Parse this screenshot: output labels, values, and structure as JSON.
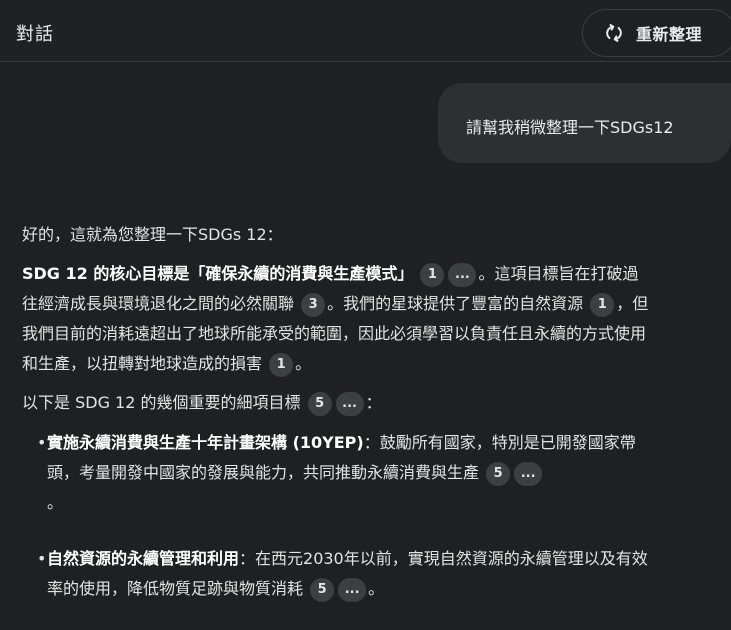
{
  "header": {
    "title": "對話",
    "regenerate_label": "重新整理",
    "regenerate_icon": "refresh-icon"
  },
  "user_message": "請幫我稍微整理一下SDGs12",
  "answer": {
    "intro": "好的，這就為您整理一下SDGs 12：",
    "core": {
      "bold": "SDG 12 的核心目標是「確保永續的消費與生產模式」",
      "text1": "。這項目標旨在打破過往經濟成長與環境退化之間的必然關聯",
      "text2": "。我們的星球提供了豐富的自然資源",
      "text3": "，但我們目前的消耗遠超出了地球所能承受的範圍，因此必須學習以負責任且永續的方式使用和生產，以扭轉對地球造成的損害",
      "text4": "。"
    },
    "targets_intro": {
      "text": "以下是 SDG 12 的幾個重要的細項目標",
      "tail": "："
    },
    "targets": [
      {
        "bold": "實施永續消費與生產十年計畫架構 (10YEP)",
        "text": "：鼓勵所有國家，特別是已開發國家帶頭，考量開發中國家的發展與能力，共同推動永續消費與生產",
        "tail": "。",
        "cite": "5",
        "more": "..."
      },
      {
        "bold": "自然資源的永續管理和利用",
        "text": "：在西元2030年以前，實現自然資源的永續管理以及有效率的使用，降低物質足跡與物質消耗",
        "tail": "。",
        "cite": "5",
        "more": "..."
      }
    ],
    "citations": {
      "c1": "1",
      "c3": "3",
      "c5": "5",
      "more": "..."
    }
  }
}
